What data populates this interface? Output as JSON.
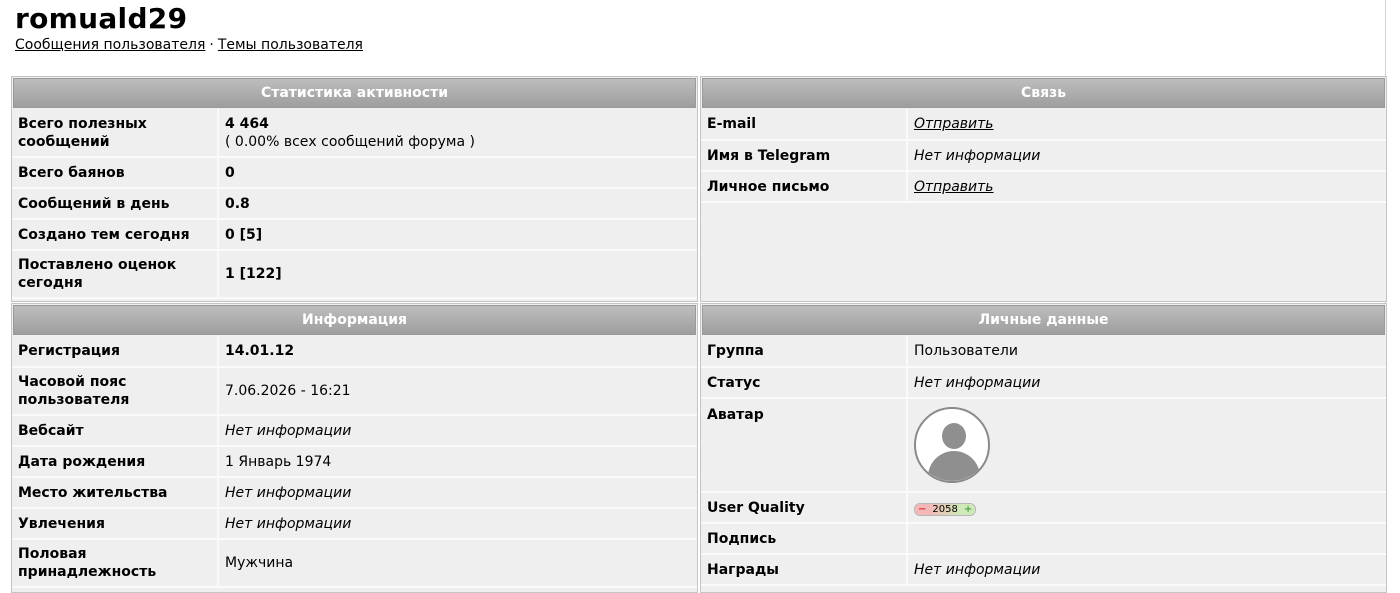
{
  "profile": {
    "username": "romuald29",
    "link_posts": "Сообщения пользователя",
    "link_separator": "·",
    "link_topics": "Темы пользователя"
  },
  "activity": {
    "title": "Статистика активности",
    "rows": [
      {
        "label": "Всего полезных сообщений",
        "value": "4 464",
        "sub": "( 0.00% всех сообщений форума )"
      },
      {
        "label": "Всего баянов",
        "value": "0"
      },
      {
        "label": "Сообщений в день",
        "value": "0.8"
      },
      {
        "label": "Создано тем сегодня",
        "value": "0 [5]"
      },
      {
        "label": "Поставлено оценок сегодня",
        "value": "1 [122]"
      }
    ]
  },
  "contact": {
    "title": "Связь",
    "rows": [
      {
        "label": "E-mail",
        "value": "Отправить"
      },
      {
        "label": "Имя в Telegram",
        "value": "Нет информации"
      },
      {
        "label": "Личное письмо",
        "value": "Отправить"
      }
    ]
  },
  "info": {
    "title": "Информация",
    "rows": [
      {
        "label": "Регистрация",
        "value": "14.01.12"
      },
      {
        "label": "Часовой пояс пользователя",
        "value": "7.06.2026 - 16:21"
      },
      {
        "label": "Вебсайт",
        "value": "Нет информации"
      },
      {
        "label": "Дата рождения",
        "value": "1 Январь 1974"
      },
      {
        "label": "Место жительства",
        "value": "Нет информации"
      },
      {
        "label": "Увлечения",
        "value": "Нет информации"
      },
      {
        "label": "Половая принадлежность",
        "value": "Мужчина"
      }
    ]
  },
  "personal": {
    "title": "Личные данные",
    "rows": [
      {
        "label": "Группа",
        "value": "Пользователи"
      },
      {
        "label": "Статус",
        "value": "Нет информации"
      },
      {
        "label": "Аватар",
        "value": ""
      },
      {
        "label": "User Quality",
        "value": "2058",
        "minus": "−",
        "plus": "+"
      },
      {
        "label": "Подпись",
        "value": ""
      },
      {
        "label": "Награды",
        "value": "Нет информации"
      }
    ]
  }
}
